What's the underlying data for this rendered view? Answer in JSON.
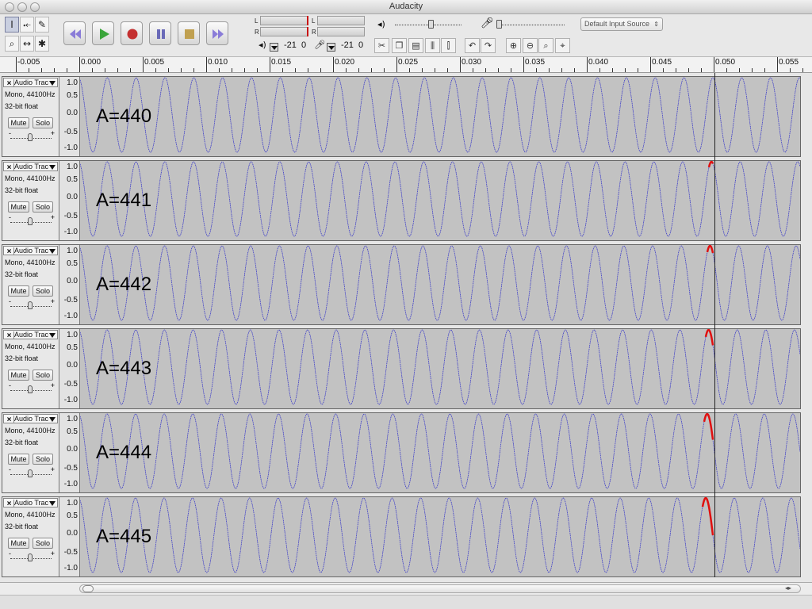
{
  "window": {
    "title": "Audacity"
  },
  "toolbar": {
    "tools": {
      "select": "I",
      "envelope": "⤝",
      "draw": "✎",
      "zoom": "⌕",
      "timeshift": "↔",
      "multi": "✱"
    },
    "meters": {
      "left": "L",
      "right": "R",
      "play_db": "-21",
      "play_db2": "0",
      "rec_db": "-21",
      "rec_db2": "0"
    },
    "input_source": "Default Input Source",
    "colors": {
      "play": "#3aa53a",
      "record": "#c43030",
      "skip": "#7a6cc8",
      "stop": "#c0a050"
    }
  },
  "ruler": {
    "labels": [
      "-0.005",
      "0.000",
      "0.005",
      "0.010",
      "0.015",
      "0.020",
      "0.025",
      "0.030",
      "0.035",
      "0.040",
      "0.045",
      "0.050",
      "0.055"
    ]
  },
  "tracks": [
    {
      "name": "Audio Trac",
      "format": "Mono, 44100Hz",
      "bits": "32-bit float",
      "mute": "Mute",
      "solo": "Solo",
      "label": "A=440",
      "freq": 440,
      "scale": [
        "1.0",
        "0.5",
        "0.0",
        "-0.5",
        "-1.0"
      ]
    },
    {
      "name": "Audio Trac",
      "format": "Mono, 44100Hz",
      "bits": "32-bit float",
      "mute": "Mute",
      "solo": "Solo",
      "label": "A=441",
      "freq": 441,
      "scale": [
        "1.0",
        "0.5",
        "0.0",
        "-0.5",
        "-1.0"
      ]
    },
    {
      "name": "Audio Trac",
      "format": "Mono, 44100Hz",
      "bits": "32-bit float",
      "mute": "Mute",
      "solo": "Solo",
      "label": "A=442",
      "freq": 442,
      "scale": [
        "1.0",
        "0.5",
        "0.0",
        "-0.5",
        "-1.0"
      ]
    },
    {
      "name": "Audio Trac",
      "format": "Mono, 44100Hz",
      "bits": "32-bit float",
      "mute": "Mute",
      "solo": "Solo",
      "label": "A=443",
      "freq": 443,
      "scale": [
        "1.0",
        "0.5",
        "0.0",
        "-0.5",
        "-1.0"
      ]
    },
    {
      "name": "Audio Trac",
      "format": "Mono, 44100Hz",
      "bits": "32-bit float",
      "mute": "Mute",
      "solo": "Solo",
      "label": "A=444",
      "freq": 444,
      "scale": [
        "1.0",
        "0.5",
        "0.0",
        "-0.5",
        "-1.0"
      ]
    },
    {
      "name": "Audio Trac",
      "format": "Mono, 44100Hz",
      "bits": "32-bit float",
      "mute": "Mute",
      "solo": "Solo",
      "label": "A=445",
      "freq": 445,
      "scale": [
        "1.0",
        "0.5",
        "0.0",
        "-0.5",
        "-1.0"
      ]
    }
  ],
  "cursor_time": 0.05,
  "colors": {
    "waveform": "#3b3bc8",
    "highlight": "#e01010",
    "wave_bg": "#c2c2c2"
  }
}
